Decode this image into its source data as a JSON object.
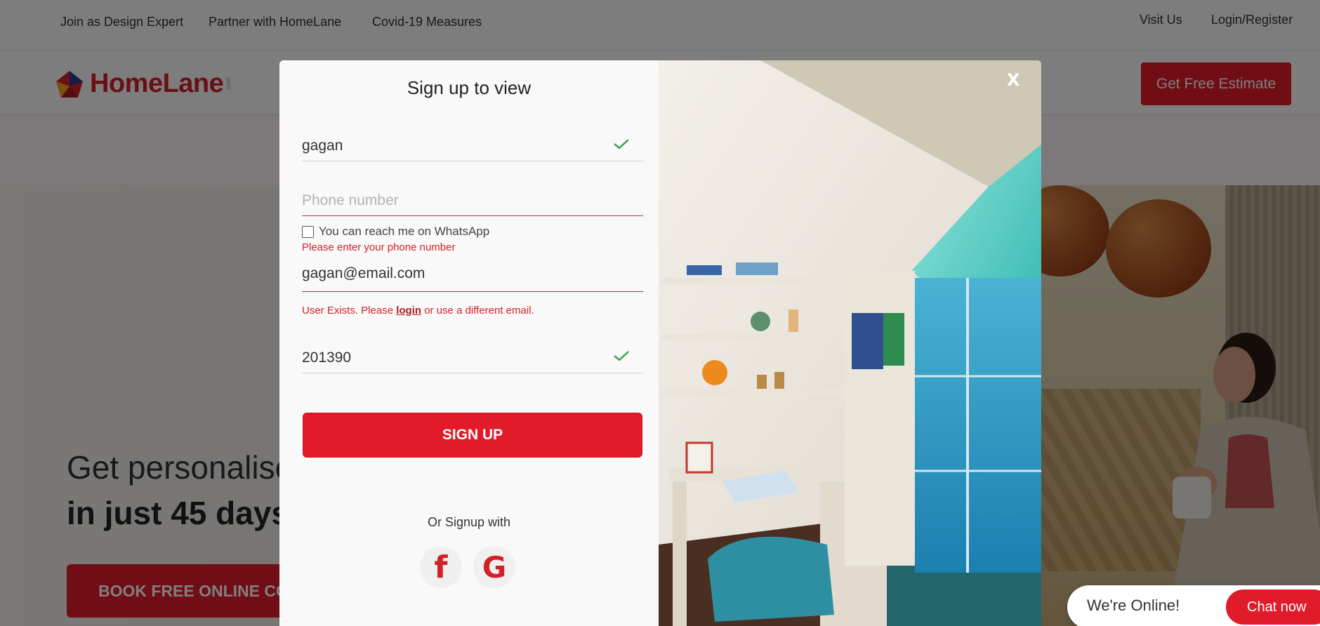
{
  "topbar": {
    "links": [
      "Join as Design Expert",
      "Partner with HomeLane",
      "Covid-19 Measures"
    ],
    "right_links": [
      "Visit Us",
      "Login/Register"
    ]
  },
  "header": {
    "brand": "HomeLane",
    "brand_suffix": ".com",
    "estimate_button": "Get Free Estimate"
  },
  "hero": {
    "headline": "Get personalised",
    "headline_bold": "in just 45 days.",
    "cta": "BOOK FREE ONLINE CO"
  },
  "modal": {
    "title": "Sign up to view",
    "name_value": "gagan",
    "phone_placeholder": "Phone number",
    "whatsapp_label": "You can reach me on WhatsApp",
    "phone_error": "Please enter your phone number",
    "email_value": "gagan@email.com",
    "email_error_pre": "User Exists. Please ",
    "email_error_link": "login",
    "email_error_post": " or use a different email.",
    "pincode_value": "201390",
    "signup_button": "SIGN UP",
    "or_text": "Or Signup with",
    "facebook_glyph": "f",
    "google_glyph": "G",
    "close_label": "X"
  },
  "chat": {
    "status": "We're Online!",
    "button": "Chat now"
  },
  "colors": {
    "brand_red": "#e11b2a",
    "success_green": "#3aa54a",
    "error_red": "#d32128"
  }
}
